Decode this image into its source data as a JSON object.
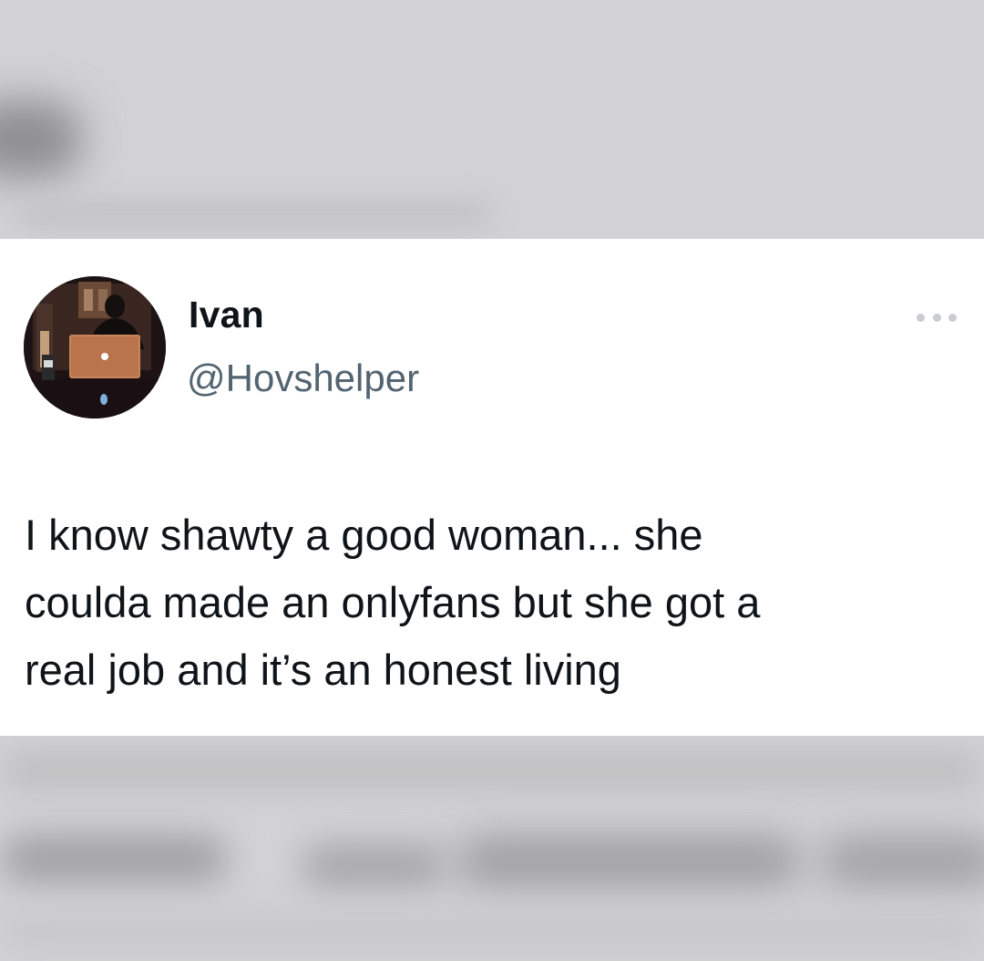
{
  "tweet": {
    "author": {
      "display_name": "Ivan",
      "handle": "@Hovshelper",
      "avatar_icon": "profile-photo"
    },
    "text": "I know shawty a good woman... she\ncoulda made an onlyfans but she got a\nreal job and it’s an honest living",
    "more_icon": "more-horizontal-icon"
  },
  "colors": {
    "name": "#0f1419",
    "handle": "#536471",
    "card_background": "#ffffff",
    "backdrop": "#d3d3d5"
  }
}
